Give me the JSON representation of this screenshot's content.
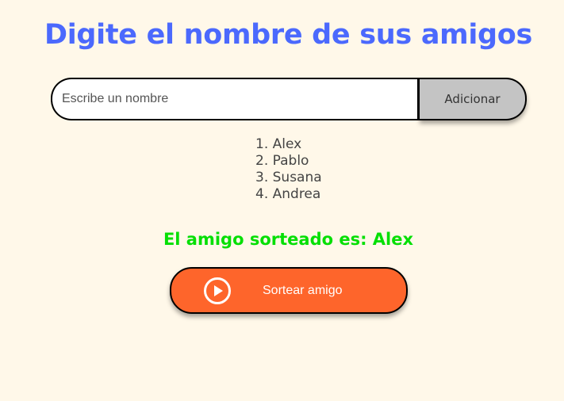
{
  "header": {
    "title": "Digite el nombre de sus amigos"
  },
  "input": {
    "placeholder": "Escribe un nombre",
    "value": ""
  },
  "add_button": {
    "label": "Adicionar"
  },
  "friends": [
    "1. Alex",
    "2. Pablo",
    "3. Susana",
    "4. Andrea"
  ],
  "result": {
    "text": "El amigo sorteado es: Alex"
  },
  "draw_button": {
    "label": "Sortear amigo",
    "icon": "play-circle-icon"
  },
  "colors": {
    "background": "#fff8e9",
    "title": "#4b69fd",
    "result": "#05df05",
    "draw_button": "#fe652b",
    "add_button": "#c4c4c4"
  }
}
